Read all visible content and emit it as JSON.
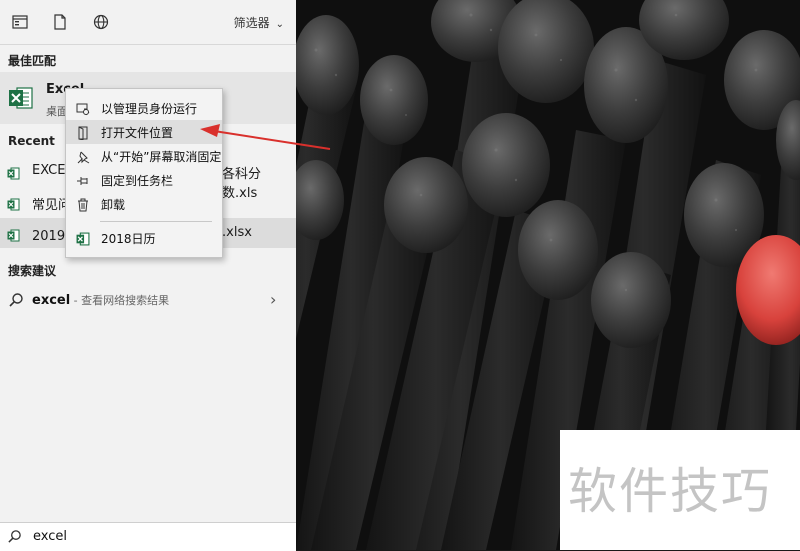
{
  "topbar": {
    "icons": [
      "apps-icon",
      "document-icon",
      "web-globe-icon"
    ],
    "filter_label": "筛选器"
  },
  "best_match": {
    "section_label": "最佳匹配",
    "app_name": "Excel",
    "app_subtitle": "桌面",
    "icon": "excel-icon"
  },
  "recent": {
    "section_label": "Recent",
    "items": [
      {
        "prefix": "EXCEL",
        "suffix": "各科分数.xls",
        "icon": "excel-file-icon"
      },
      {
        "prefix": "常见问",
        "suffix": "",
        "icon": "excel-file-icon"
      },
      {
        "prefix": "2019年",
        "suffix": ".xlsx",
        "icon": "excel-file-icon"
      }
    ]
  },
  "context_menu": {
    "items": [
      {
        "label": "以管理员身份运行",
        "icon": "run-as-admin-icon"
      },
      {
        "label": "打开文件位置",
        "icon": "open-file-location-icon",
        "highlighted": true
      },
      {
        "label": "从“开始”屏幕取消固定",
        "icon": "unpin-start-icon"
      },
      {
        "label": "固定到任务栏",
        "icon": "pin-taskbar-icon"
      },
      {
        "label": "卸载",
        "icon": "trash-icon"
      },
      {
        "label": "2018日历",
        "icon": "excel-file-icon"
      }
    ]
  },
  "search_suggestions": {
    "section_label": "搜索建议",
    "query": "excel",
    "hint": " - 查看网络搜索结果"
  },
  "search_box": {
    "value": "excel"
  },
  "watermark": "软件技巧",
  "colors": {
    "excel_green": "#1e7145",
    "arrow_red": "#d9302c",
    "panel_bg": "#f2f2f2"
  }
}
